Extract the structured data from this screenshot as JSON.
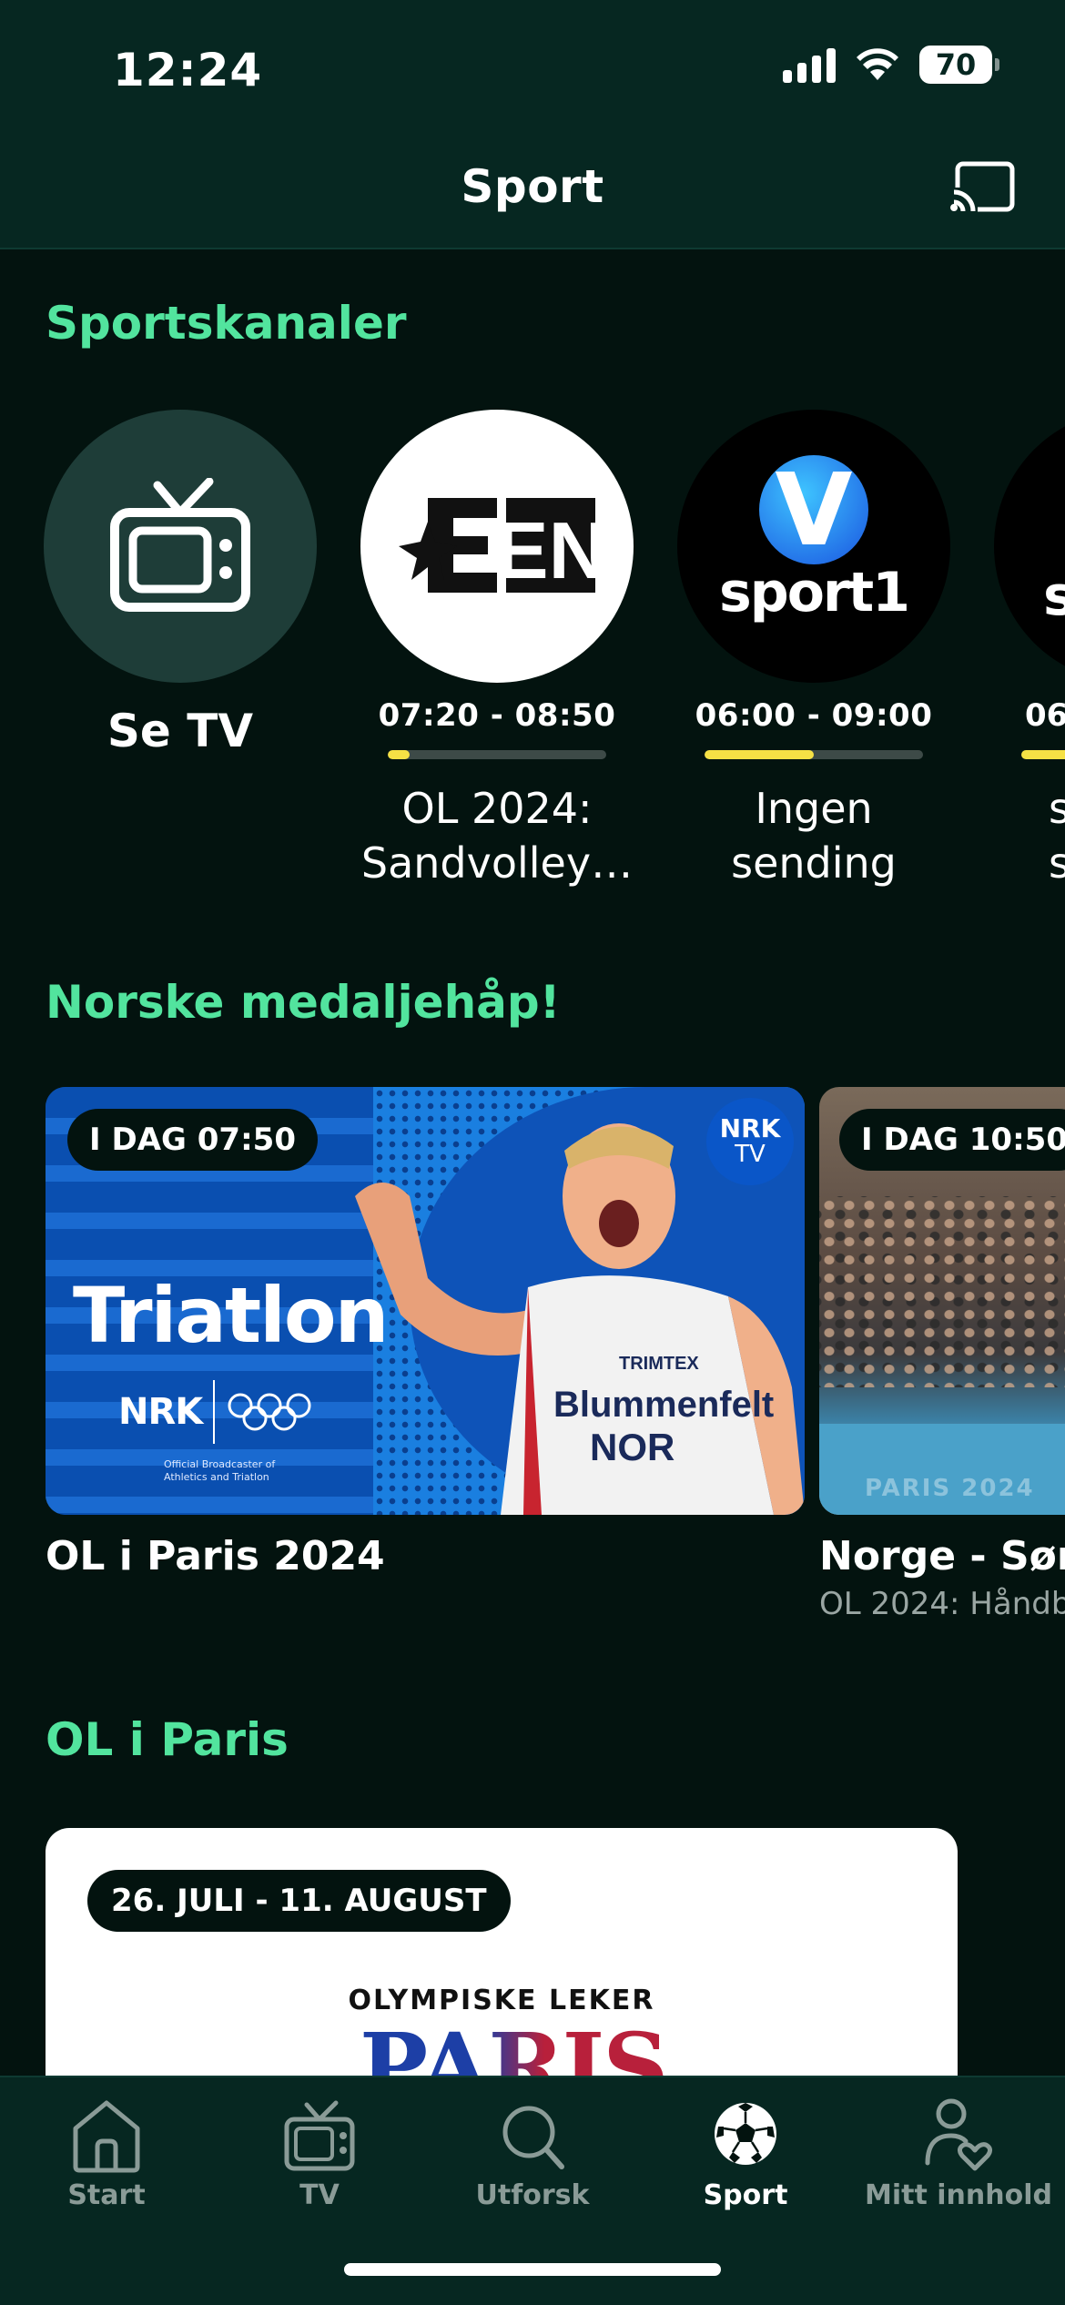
{
  "status_bar": {
    "time": "12:24",
    "battery": "70"
  },
  "header": {
    "title": "Sport"
  },
  "sections": {
    "channels": "Sportskanaler",
    "medals": "Norske medaljehåp!",
    "paris": "OL i Paris"
  },
  "channels": [
    {
      "name": "Se TV",
      "icon": "tv-icon"
    },
    {
      "time": "07:20 - 08:50",
      "progress": 0.1,
      "title_line1": "OL 2024:",
      "title_line2": "Sandvolley…",
      "logo": "EN"
    },
    {
      "time": "06:00 - 09:00",
      "progress": 0.5,
      "title_line1": "Ingen",
      "title_line2": "sending",
      "logo_text": "sport1",
      "logo_letter": "V"
    },
    {
      "time": "06",
      "title_line1": "s",
      "title_line2": "s",
      "logo_text": "s"
    }
  ],
  "medal_cards": [
    {
      "badge": "I DAG 07:50",
      "caption": "OL i Paris 2024",
      "poster_title": "Triatlon",
      "nrk_logo": "NRK",
      "nrk_tv_logo_line1": "NRK",
      "nrk_tv_logo_line2": "TV",
      "broadcaster_note_1": "Official Broadcaster of",
      "broadcaster_note_2": "Athletics and Triatlon",
      "athlete_shirt_brand": "TRIMTEX",
      "athlete_name": "Blummenfelt",
      "athlete_country": "NOR"
    },
    {
      "badge": "I DAG 10:50",
      "caption": "Norge - Sør",
      "subtitle": "OL 2024: Håndb",
      "board_text": "PARIS 2024"
    }
  ],
  "paris_card": {
    "badge": "26. JULI - 11. AUGUST",
    "subtitle": "OLYMPISKE LEKER",
    "logo": "PARIS"
  },
  "nav": [
    {
      "label": "Start",
      "icon": "home-icon",
      "active": false
    },
    {
      "label": "TV",
      "icon": "tv-icon",
      "active": false
    },
    {
      "label": "Utforsk",
      "icon": "search-icon",
      "active": false
    },
    {
      "label": "Sport",
      "icon": "football-icon",
      "active": true
    },
    {
      "label": "Mitt innhold",
      "icon": "profile-heart-icon",
      "active": false
    }
  ],
  "colors": {
    "accent": "#52e49e",
    "progress": "#f6e145",
    "background": "#03130f",
    "header": "#062721"
  }
}
